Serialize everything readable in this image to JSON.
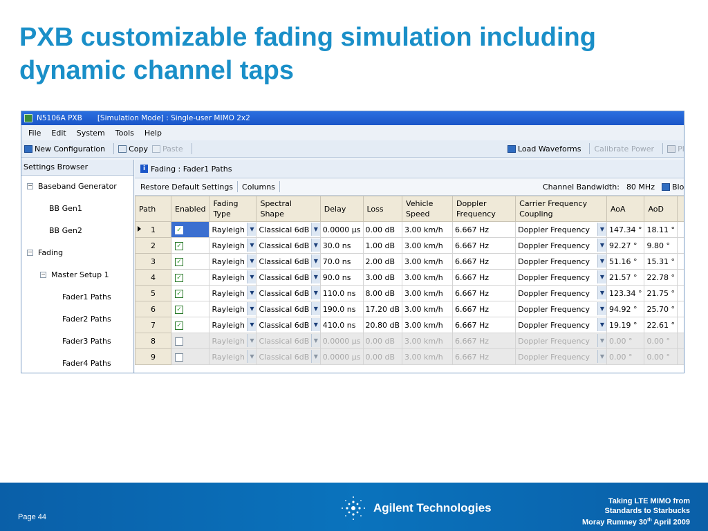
{
  "slide": {
    "title": "PXB customizable fading simulation including dynamic channel taps",
    "page": "Page 44",
    "brand": "Agilent Technologies",
    "footnote_line1": "Taking LTE MIMO from",
    "footnote_line2": "Standards to Starbucks",
    "footnote_line3_pre": "Moray Rumney 30",
    "footnote_line3_sup": "th",
    "footnote_line3_post": " April 2009"
  },
  "window": {
    "app": "N5106A PXB",
    "title": "[Simulation Mode] : Single-user MIMO 2x2"
  },
  "menu": [
    "File",
    "Edit",
    "System",
    "Tools",
    "Help"
  ],
  "toolbar": {
    "new_configuration": "New Configuration",
    "copy": "Copy",
    "paste": "Paste",
    "load_waveforms": "Load Waveforms",
    "calibrate_power": "Calibrate Power",
    "play": "Play"
  },
  "browser": {
    "header": "Settings Browser",
    "items": {
      "baseband_generator": "Baseband Generator",
      "bb_gen1": "BB Gen1",
      "bb_gen2": "BB Gen2",
      "fading": "Fading",
      "master_setup": "Master Setup 1",
      "fader1": "Fader1 Paths",
      "fader2": "Fader2 Paths",
      "fader3": "Fader3 Paths",
      "fader4": "Fader4 Paths"
    }
  },
  "panel": {
    "header": "Fading : Fader1 Paths",
    "restore_defaults": "Restore Default Settings",
    "columns": "Columns",
    "channel_bandwidth_label": "Channel Bandwidth:",
    "channel_bandwidth_value": "80 MHz",
    "block": "Block"
  },
  "table": {
    "headers": {
      "path": "Path",
      "enabled": "Enabled",
      "fading_type_1": "Fading",
      "fading_type_2": "Type",
      "spectral_shape": "Spectral Shape",
      "delay": "Delay",
      "loss": "Loss",
      "vehicle_1": "Vehicle",
      "vehicle_2": "Speed",
      "doppler_1": "Doppler",
      "doppler_2": "Frequency",
      "carrier_1": "Carrier Frequency",
      "carrier_2": "Coupling",
      "aoa": "AoA",
      "aod": "AoD"
    },
    "rows": [
      {
        "path": "1",
        "enabled": true,
        "fading_type": "Rayleigh",
        "spectral_shape": "Classical 6dB",
        "delay": "0.0000 µs",
        "loss": "0.00 dB",
        "speed": "3.00 km/h",
        "doppler": "6.667 Hz",
        "coupling": "Doppler Frequency",
        "aoa": "147.34 °",
        "aod": "18.11 °"
      },
      {
        "path": "2",
        "enabled": true,
        "fading_type": "Rayleigh",
        "spectral_shape": "Classical 6dB",
        "delay": "30.0 ns",
        "loss": "1.00 dB",
        "speed": "3.00 km/h",
        "doppler": "6.667 Hz",
        "coupling": "Doppler Frequency",
        "aoa": "92.27 °",
        "aod": "9.80 °"
      },
      {
        "path": "3",
        "enabled": true,
        "fading_type": "Rayleigh",
        "spectral_shape": "Classical 6dB",
        "delay": "70.0 ns",
        "loss": "2.00 dB",
        "speed": "3.00 km/h",
        "doppler": "6.667 Hz",
        "coupling": "Doppler Frequency",
        "aoa": "51.16 °",
        "aod": "15.31 °"
      },
      {
        "path": "4",
        "enabled": true,
        "fading_type": "Rayleigh",
        "spectral_shape": "Classical 6dB",
        "delay": "90.0 ns",
        "loss": "3.00 dB",
        "speed": "3.00 km/h",
        "doppler": "6.667 Hz",
        "coupling": "Doppler Frequency",
        "aoa": "21.57 °",
        "aod": "22.78 °"
      },
      {
        "path": "5",
        "enabled": true,
        "fading_type": "Rayleigh",
        "spectral_shape": "Classical 6dB",
        "delay": "110.0 ns",
        "loss": "8.00 dB",
        "speed": "3.00 km/h",
        "doppler": "6.667 Hz",
        "coupling": "Doppler Frequency",
        "aoa": "123.34 °",
        "aod": "21.75 °"
      },
      {
        "path": "6",
        "enabled": true,
        "fading_type": "Rayleigh",
        "spectral_shape": "Classical 6dB",
        "delay": "190.0 ns",
        "loss": "17.20 dB",
        "speed": "3.00 km/h",
        "doppler": "6.667 Hz",
        "coupling": "Doppler Frequency",
        "aoa": "94.92 °",
        "aod": "25.70 °"
      },
      {
        "path": "7",
        "enabled": true,
        "fading_type": "Rayleigh",
        "spectral_shape": "Classical 6dB",
        "delay": "410.0 ns",
        "loss": "20.80 dB",
        "speed": "3.00 km/h",
        "doppler": "6.667 Hz",
        "coupling": "Doppler Frequency",
        "aoa": "19.19 °",
        "aod": "22.61 °"
      },
      {
        "path": "8",
        "enabled": false,
        "fading_type": "Rayleigh",
        "spectral_shape": "Classical 6dB",
        "delay": "0.0000 µs",
        "loss": "0.00 dB",
        "speed": "3.00 km/h",
        "doppler": "6.667 Hz",
        "coupling": "Doppler Frequency",
        "aoa": "0.00 °",
        "aod": "0.00 °"
      },
      {
        "path": "9",
        "enabled": false,
        "fading_type": "Rayleigh",
        "spectral_shape": "Classical 6dB",
        "delay": "0.0000 µs",
        "loss": "0.00 dB",
        "speed": "3.00 km/h",
        "doppler": "6.667 Hz",
        "coupling": "Doppler Frequency",
        "aoa": "0.00 °",
        "aod": "0.00 °"
      }
    ]
  },
  "colors": {
    "title": "#1a8fc8",
    "footer": "#0a6ab3",
    "titlebar": "#1b56c8",
    "selection": "#3b6fd0"
  }
}
